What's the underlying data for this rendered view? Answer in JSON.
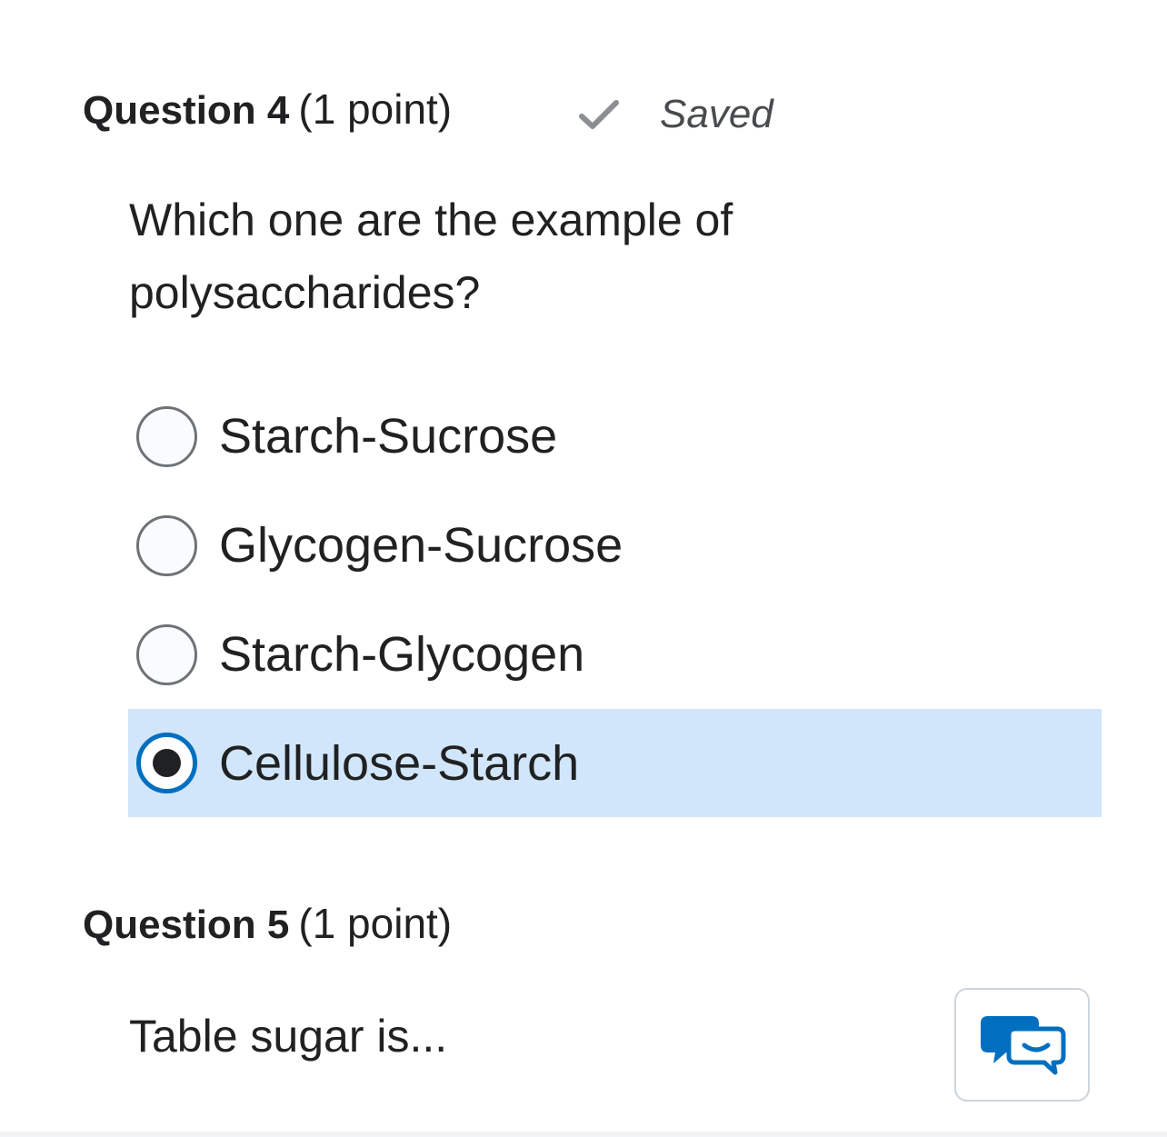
{
  "question4": {
    "number": "Question 4",
    "points": "(1 point)",
    "status": "Saved",
    "text": "Which one are the example of polysaccharides?",
    "options": [
      {
        "label": "Starch-Sucrose",
        "selected": false
      },
      {
        "label": "Glycogen-Sucrose",
        "selected": false
      },
      {
        "label": "Starch-Glycogen",
        "selected": false
      },
      {
        "label": "Cellulose-Starch",
        "selected": true
      }
    ]
  },
  "question5": {
    "number": "Question 5",
    "points": "(1 point)",
    "text": "Table sugar is..."
  },
  "colors": {
    "selected_background": "#d1e6fa",
    "selected_radio_border": "#006fbf",
    "chat_icon": "#006fbf"
  },
  "icons": {
    "saved": "check-icon",
    "chat": "chat-bubbles-icon"
  }
}
